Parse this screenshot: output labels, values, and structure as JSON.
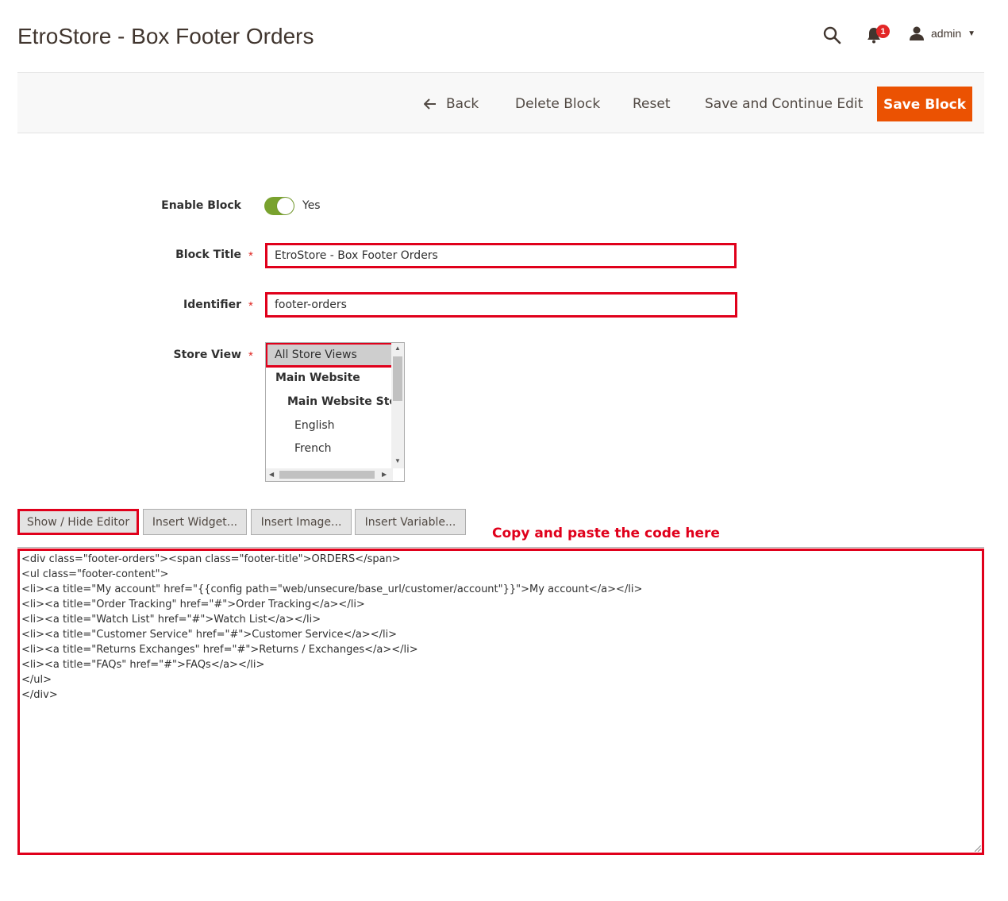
{
  "header": {
    "title": "EtroStore - Box Footer Orders",
    "notification_count": "1",
    "user_name": "admin",
    "icons": [
      "search-icon",
      "bell-icon",
      "user-icon",
      "caret-down-icon"
    ]
  },
  "actions": {
    "back": "Back",
    "delete": "Delete Block",
    "reset": "Reset",
    "save_continue": "Save and Continue Edit",
    "save": "Save Block",
    "accent_color": "#eb5202"
  },
  "form": {
    "enable_label": "Enable Block",
    "enable_value": "Yes",
    "title_label": "Block Title",
    "title_value": "EtroStore - Box Footer Orders",
    "identifier_label": "Identifier",
    "identifier_value": "footer-orders",
    "store_view_label": "Store View",
    "required_mark": "*",
    "store_options": [
      "All Store Views",
      "Main Website",
      "Main Website Store",
      "English",
      "French"
    ]
  },
  "editor": {
    "show_hide": "Show / Hide Editor",
    "insert_widget": "Insert Widget...",
    "insert_image": "Insert Image...",
    "insert_variable": "Insert Variable...",
    "annotation": "Copy and paste the code here",
    "highlight_color": "#e0001b",
    "code_lines": [
      "<div class=\"footer-orders\"><span class=\"footer-title\">ORDERS</span>",
      "<ul class=\"footer-content\">",
      "<li><a title=\"My account\" href=\"{{config path=\"web/unsecure/base_url/customer/account\"}}\">My account</a></li>",
      "<li><a title=\"Order Tracking\" href=\"#\">Order Tracking</a></li>",
      "<li><a title=\"Watch List\" href=\"#\">Watch List</a></li>",
      "<li><a title=\"Customer Service\" href=\"#\">Customer Service</a></li>",
      "<li><a title=\"Returns Exchanges\" href=\"#\">Returns / Exchanges</a></li>",
      "<li><a title=\"FAQs\" href=\"#\">FAQs</a></li>",
      "</ul>",
      "</div>"
    ]
  }
}
